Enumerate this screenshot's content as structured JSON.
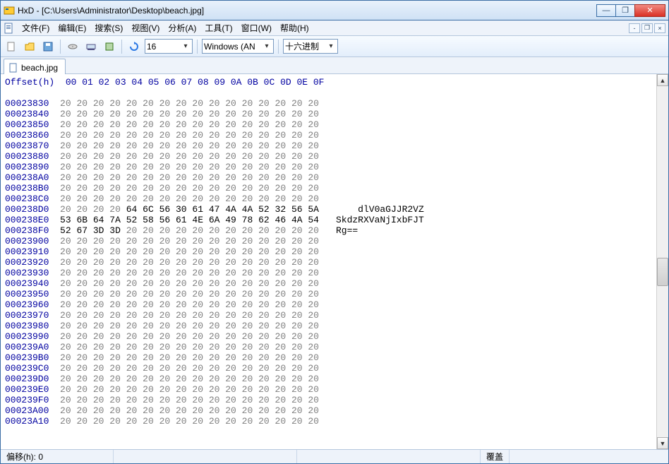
{
  "window": {
    "title": "HxD - [C:\\Users\\Administrator\\Desktop\\beach.jpg]"
  },
  "menu": {
    "items": [
      "文件(F)",
      "编辑(E)",
      "搜索(S)",
      "视图(V)",
      "分析(A)",
      "工具(T)",
      "窗口(W)",
      "帮助(H)"
    ]
  },
  "toolbar": {
    "bytes_per_row": "16",
    "charset": "Windows (AN",
    "radix": "十六进制"
  },
  "tab": {
    "label": "beach.jpg"
  },
  "hex": {
    "offset_label": "Offset(h)",
    "cols": [
      "00",
      "01",
      "02",
      "03",
      "04",
      "05",
      "06",
      "07",
      "08",
      "09",
      "0A",
      "0B",
      "0C",
      "0D",
      "0E",
      "0F"
    ],
    "rows": [
      {
        "o": "00023830",
        "b": [
          "20",
          "20",
          "20",
          "20",
          "20",
          "20",
          "20",
          "20",
          "20",
          "20",
          "20",
          "20",
          "20",
          "20",
          "20",
          "20"
        ],
        "a": ""
      },
      {
        "o": "00023840",
        "b": [
          "20",
          "20",
          "20",
          "20",
          "20",
          "20",
          "20",
          "20",
          "20",
          "20",
          "20",
          "20",
          "20",
          "20",
          "20",
          "20"
        ],
        "a": ""
      },
      {
        "o": "00023850",
        "b": [
          "20",
          "20",
          "20",
          "20",
          "20",
          "20",
          "20",
          "20",
          "20",
          "20",
          "20",
          "20",
          "20",
          "20",
          "20",
          "20"
        ],
        "a": ""
      },
      {
        "o": "00023860",
        "b": [
          "20",
          "20",
          "20",
          "20",
          "20",
          "20",
          "20",
          "20",
          "20",
          "20",
          "20",
          "20",
          "20",
          "20",
          "20",
          "20"
        ],
        "a": ""
      },
      {
        "o": "00023870",
        "b": [
          "20",
          "20",
          "20",
          "20",
          "20",
          "20",
          "20",
          "20",
          "20",
          "20",
          "20",
          "20",
          "20",
          "20",
          "20",
          "20"
        ],
        "a": ""
      },
      {
        "o": "00023880",
        "b": [
          "20",
          "20",
          "20",
          "20",
          "20",
          "20",
          "20",
          "20",
          "20",
          "20",
          "20",
          "20",
          "20",
          "20",
          "20",
          "20"
        ],
        "a": ""
      },
      {
        "o": "00023890",
        "b": [
          "20",
          "20",
          "20",
          "20",
          "20",
          "20",
          "20",
          "20",
          "20",
          "20",
          "20",
          "20",
          "20",
          "20",
          "20",
          "20"
        ],
        "a": ""
      },
      {
        "o": "000238A0",
        "b": [
          "20",
          "20",
          "20",
          "20",
          "20",
          "20",
          "20",
          "20",
          "20",
          "20",
          "20",
          "20",
          "20",
          "20",
          "20",
          "20"
        ],
        "a": ""
      },
      {
        "o": "000238B0",
        "b": [
          "20",
          "20",
          "20",
          "20",
          "20",
          "20",
          "20",
          "20",
          "20",
          "20",
          "20",
          "20",
          "20",
          "20",
          "20",
          "20"
        ],
        "a": ""
      },
      {
        "o": "000238C0",
        "b": [
          "20",
          "20",
          "20",
          "20",
          "20",
          "20",
          "20",
          "20",
          "20",
          "20",
          "20",
          "20",
          "20",
          "20",
          "20",
          "20"
        ],
        "a": ""
      },
      {
        "o": "000238D0",
        "b": [
          "20",
          "20",
          "20",
          "20",
          "64",
          "6C",
          "56",
          "30",
          "61",
          "47",
          "4A",
          "4A",
          "52",
          "32",
          "56",
          "5A"
        ],
        "a": "    dlV0aGJJR2VZ"
      },
      {
        "o": "000238E0",
        "b": [
          "53",
          "6B",
          "64",
          "7A",
          "52",
          "58",
          "56",
          "61",
          "4E",
          "6A",
          "49",
          "78",
          "62",
          "46",
          "4A",
          "54"
        ],
        "a": "SkdzRXVaNjIxbFJT"
      },
      {
        "o": "000238F0",
        "b": [
          "52",
          "67",
          "3D",
          "3D",
          "20",
          "20",
          "20",
          "20",
          "20",
          "20",
          "20",
          "20",
          "20",
          "20",
          "20",
          "20"
        ],
        "a": "Rg=="
      },
      {
        "o": "00023900",
        "b": [
          "20",
          "20",
          "20",
          "20",
          "20",
          "20",
          "20",
          "20",
          "20",
          "20",
          "20",
          "20",
          "20",
          "20",
          "20",
          "20"
        ],
        "a": ""
      },
      {
        "o": "00023910",
        "b": [
          "20",
          "20",
          "20",
          "20",
          "20",
          "20",
          "20",
          "20",
          "20",
          "20",
          "20",
          "20",
          "20",
          "20",
          "20",
          "20"
        ],
        "a": ""
      },
      {
        "o": "00023920",
        "b": [
          "20",
          "20",
          "20",
          "20",
          "20",
          "20",
          "20",
          "20",
          "20",
          "20",
          "20",
          "20",
          "20",
          "20",
          "20",
          "20"
        ],
        "a": ""
      },
      {
        "o": "00023930",
        "b": [
          "20",
          "20",
          "20",
          "20",
          "20",
          "20",
          "20",
          "20",
          "20",
          "20",
          "20",
          "20",
          "20",
          "20",
          "20",
          "20"
        ],
        "a": ""
      },
      {
        "o": "00023940",
        "b": [
          "20",
          "20",
          "20",
          "20",
          "20",
          "20",
          "20",
          "20",
          "20",
          "20",
          "20",
          "20",
          "20",
          "20",
          "20",
          "20"
        ],
        "a": ""
      },
      {
        "o": "00023950",
        "b": [
          "20",
          "20",
          "20",
          "20",
          "20",
          "20",
          "20",
          "20",
          "20",
          "20",
          "20",
          "20",
          "20",
          "20",
          "20",
          "20"
        ],
        "a": ""
      },
      {
        "o": "00023960",
        "b": [
          "20",
          "20",
          "20",
          "20",
          "20",
          "20",
          "20",
          "20",
          "20",
          "20",
          "20",
          "20",
          "20",
          "20",
          "20",
          "20"
        ],
        "a": ""
      },
      {
        "o": "00023970",
        "b": [
          "20",
          "20",
          "20",
          "20",
          "20",
          "20",
          "20",
          "20",
          "20",
          "20",
          "20",
          "20",
          "20",
          "20",
          "20",
          "20"
        ],
        "a": ""
      },
      {
        "o": "00023980",
        "b": [
          "20",
          "20",
          "20",
          "20",
          "20",
          "20",
          "20",
          "20",
          "20",
          "20",
          "20",
          "20",
          "20",
          "20",
          "20",
          "20"
        ],
        "a": ""
      },
      {
        "o": "00023990",
        "b": [
          "20",
          "20",
          "20",
          "20",
          "20",
          "20",
          "20",
          "20",
          "20",
          "20",
          "20",
          "20",
          "20",
          "20",
          "20",
          "20"
        ],
        "a": ""
      },
      {
        "o": "000239A0",
        "b": [
          "20",
          "20",
          "20",
          "20",
          "20",
          "20",
          "20",
          "20",
          "20",
          "20",
          "20",
          "20",
          "20",
          "20",
          "20",
          "20"
        ],
        "a": ""
      },
      {
        "o": "000239B0",
        "b": [
          "20",
          "20",
          "20",
          "20",
          "20",
          "20",
          "20",
          "20",
          "20",
          "20",
          "20",
          "20",
          "20",
          "20",
          "20",
          "20"
        ],
        "a": ""
      },
      {
        "o": "000239C0",
        "b": [
          "20",
          "20",
          "20",
          "20",
          "20",
          "20",
          "20",
          "20",
          "20",
          "20",
          "20",
          "20",
          "20",
          "20",
          "20",
          "20"
        ],
        "a": ""
      },
      {
        "o": "000239D0",
        "b": [
          "20",
          "20",
          "20",
          "20",
          "20",
          "20",
          "20",
          "20",
          "20",
          "20",
          "20",
          "20",
          "20",
          "20",
          "20",
          "20"
        ],
        "a": ""
      },
      {
        "o": "000239E0",
        "b": [
          "20",
          "20",
          "20",
          "20",
          "20",
          "20",
          "20",
          "20",
          "20",
          "20",
          "20",
          "20",
          "20",
          "20",
          "20",
          "20"
        ],
        "a": ""
      },
      {
        "o": "000239F0",
        "b": [
          "20",
          "20",
          "20",
          "20",
          "20",
          "20",
          "20",
          "20",
          "20",
          "20",
          "20",
          "20",
          "20",
          "20",
          "20",
          "20"
        ],
        "a": ""
      },
      {
        "o": "00023A00",
        "b": [
          "20",
          "20",
          "20",
          "20",
          "20",
          "20",
          "20",
          "20",
          "20",
          "20",
          "20",
          "20",
          "20",
          "20",
          "20",
          "20"
        ],
        "a": ""
      },
      {
        "o": "00023A10",
        "b": [
          "20",
          "20",
          "20",
          "20",
          "20",
          "20",
          "20",
          "20",
          "20",
          "20",
          "20",
          "20",
          "20",
          "20",
          "20",
          "20"
        ],
        "a": ""
      }
    ]
  },
  "status": {
    "offset": "偏移(h): 0",
    "overwrite": "覆盖"
  }
}
